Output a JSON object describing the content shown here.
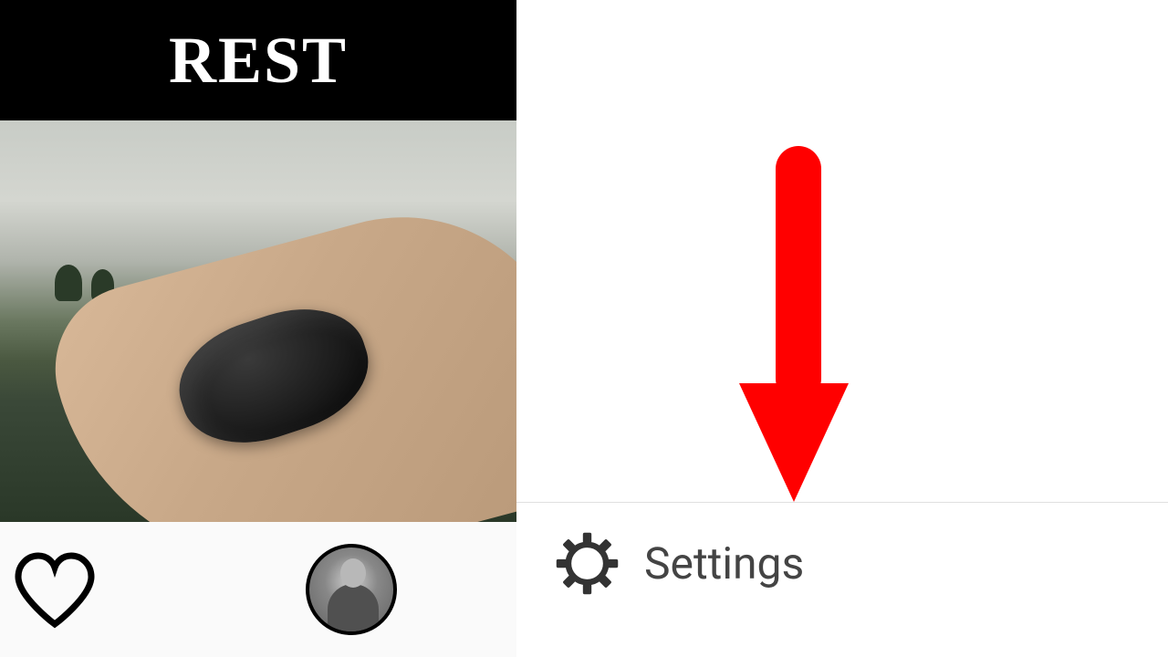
{
  "header": {
    "title": "REST"
  },
  "menu": {
    "settings_label": "Settings"
  },
  "colors": {
    "arrow": "#ff0000",
    "header_bg": "#000000",
    "text": "#444444"
  }
}
